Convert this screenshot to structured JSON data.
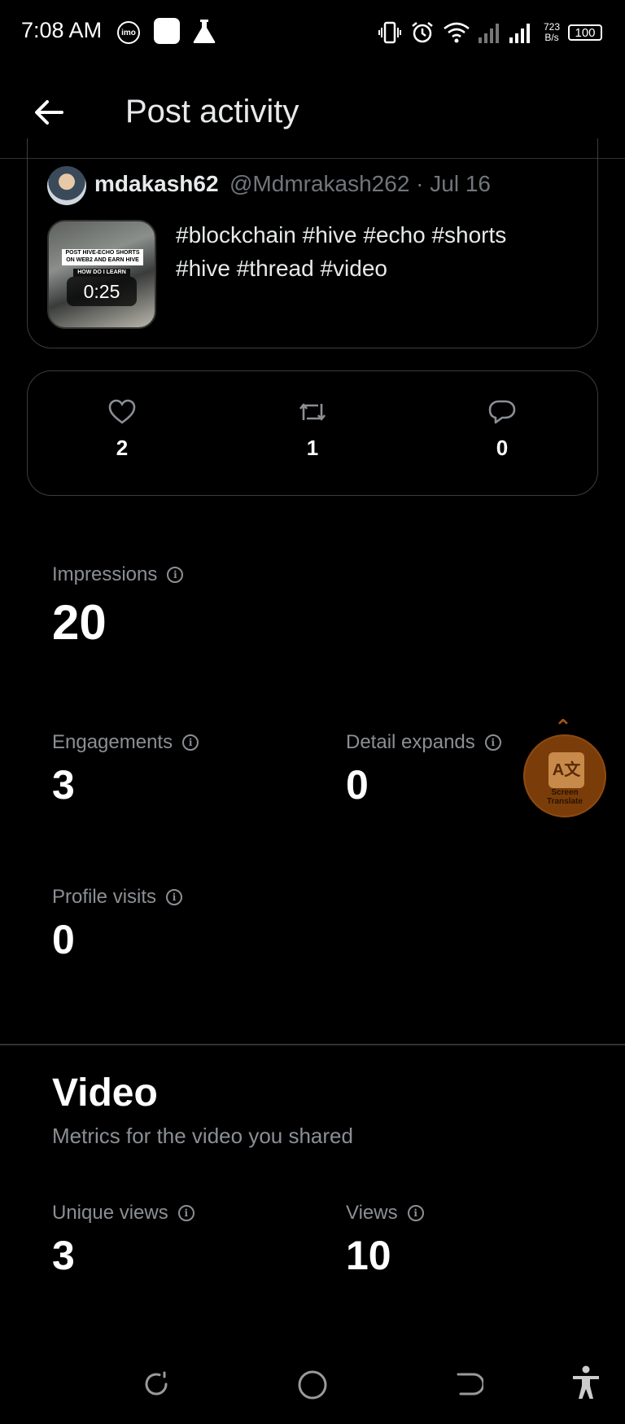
{
  "status_bar": {
    "time": "7:08 AM",
    "imo": "imo",
    "net_speed_value": "723",
    "net_speed_unit": "B/s",
    "battery": "100",
    "icons": [
      "imo-icon",
      "app-square-icon",
      "flask-icon",
      "vibrate-icon",
      "alarm-icon",
      "wifi-icon",
      "signal-icon",
      "battery-icon"
    ]
  },
  "header": {
    "title": "Post activity",
    "back_icon": "back-arrow-icon"
  },
  "post": {
    "username": "mdakash62",
    "handle_date": "@Mdmrakash262 · Jul 16",
    "text_line1": "#blockchain #hive #echo #shorts",
    "text_line2": "#hive #thread #video",
    "thumbnail_caption": "POST HIVE-ECHO SHORTS ON WEB2 AND EARN HIVE",
    "thumbnail_caption2": "HOW DO I LEARN",
    "video_duration": "0:25"
  },
  "engagement": {
    "likes": "2",
    "reposts": "1",
    "replies": "0"
  },
  "metrics": {
    "impressions_label": "Impressions",
    "impressions_value": "20",
    "engagements_label": "Engagements",
    "engagements_value": "3",
    "detail_expands_label": "Detail expands",
    "detail_expands_value": "0",
    "profile_visits_label": "Profile visits",
    "profile_visits_value": "0"
  },
  "video": {
    "title": "Video",
    "subtitle": "Metrics for the video you shared",
    "unique_views_label": "Unique views",
    "unique_views_value": "3",
    "views_label": "Views",
    "views_value": "10"
  },
  "screen_translate": {
    "line1": "Screen",
    "line2": "Translate"
  },
  "nav_icons": [
    "recents-icon",
    "home-icon",
    "back-icon",
    "accessibility-icon"
  ],
  "colors": {
    "background": "#000000",
    "secondary_text": "#8b8f94",
    "border": "#3a3d40",
    "translate_bubble": "#7a3d09"
  }
}
